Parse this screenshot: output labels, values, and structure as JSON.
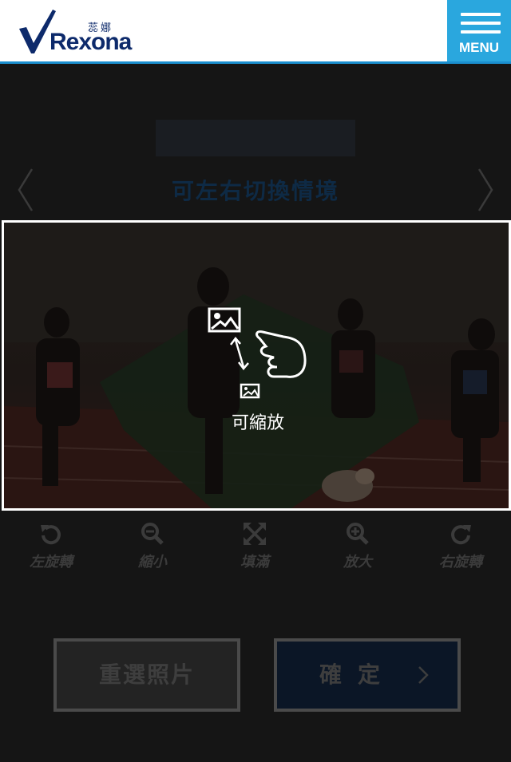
{
  "header": {
    "logo_cn": "蕊娜",
    "logo_brand": "Rexona",
    "menu_label": "MENU"
  },
  "scene": {
    "title": "可左右切換情境"
  },
  "photo": {
    "hint_text": "可縮放"
  },
  "toolbar": {
    "rotate_left": "左旋轉",
    "zoom_out": "縮小",
    "fill": "填滿",
    "zoom_in": "放大",
    "rotate_right": "右旋轉"
  },
  "buttons": {
    "reselect": "重選照片",
    "confirm": "確定"
  },
  "colors": {
    "brand_blue": "#1b8fcf",
    "menu_bg": "#2aa7de",
    "logo_navy": "#0d2a6b"
  }
}
